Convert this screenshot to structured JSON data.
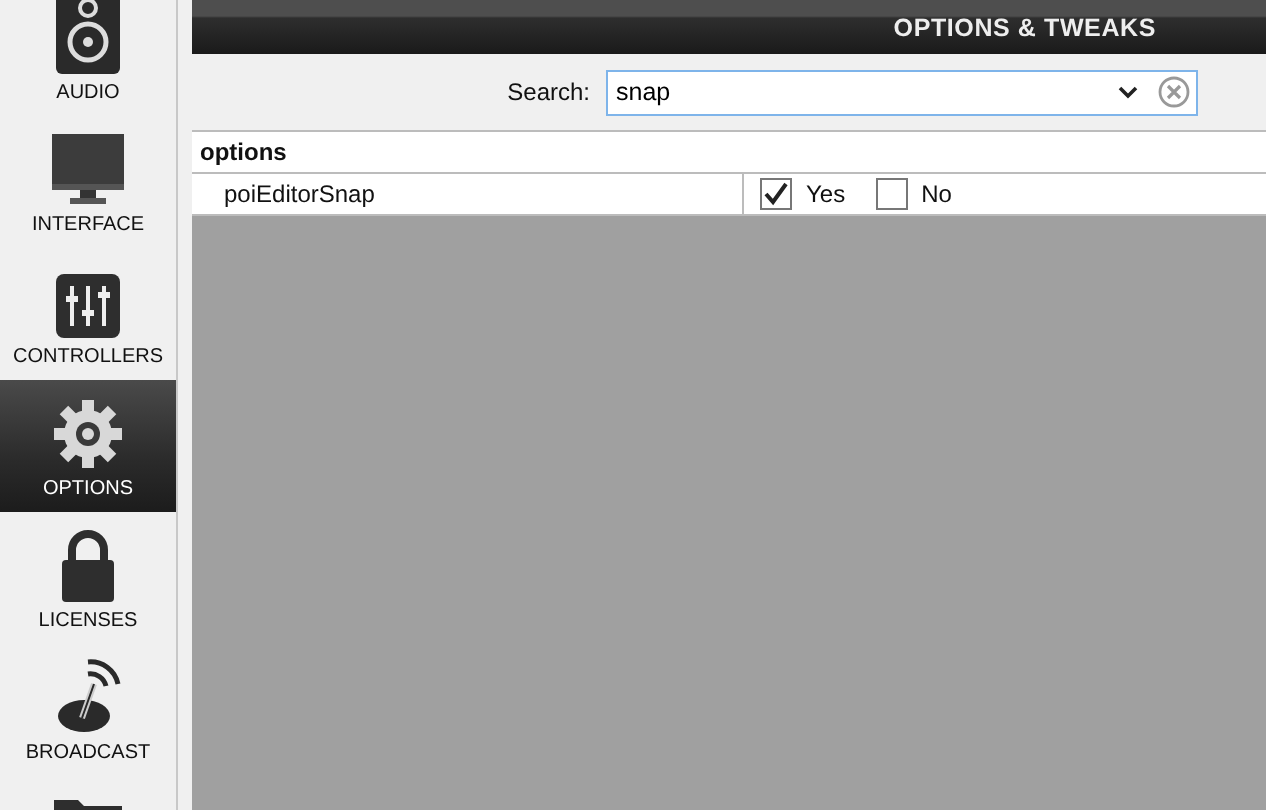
{
  "sidebar": {
    "items": [
      {
        "label": "AUDIO",
        "kind": "speaker",
        "selected": false
      },
      {
        "label": "INTERFACE",
        "kind": "monitor",
        "selected": false
      },
      {
        "label": "CONTROLLERS",
        "kind": "sliders",
        "selected": false
      },
      {
        "label": "OPTIONS",
        "kind": "gear",
        "selected": true
      },
      {
        "label": "LICENSES",
        "kind": "lock",
        "selected": false
      },
      {
        "label": "BROADCAST",
        "kind": "antenna",
        "selected": false
      },
      {
        "kind": "folder",
        "selected": false
      }
    ]
  },
  "header": {
    "title": "OPTIONS & TWEAKS"
  },
  "search": {
    "label": "Search:",
    "value": "snap"
  },
  "table": {
    "group": "options",
    "rows": [
      {
        "name": "poiEditorSnap",
        "choices": [
          {
            "label": "Yes",
            "checked": true
          },
          {
            "label": "No",
            "checked": false
          }
        ]
      }
    ]
  }
}
